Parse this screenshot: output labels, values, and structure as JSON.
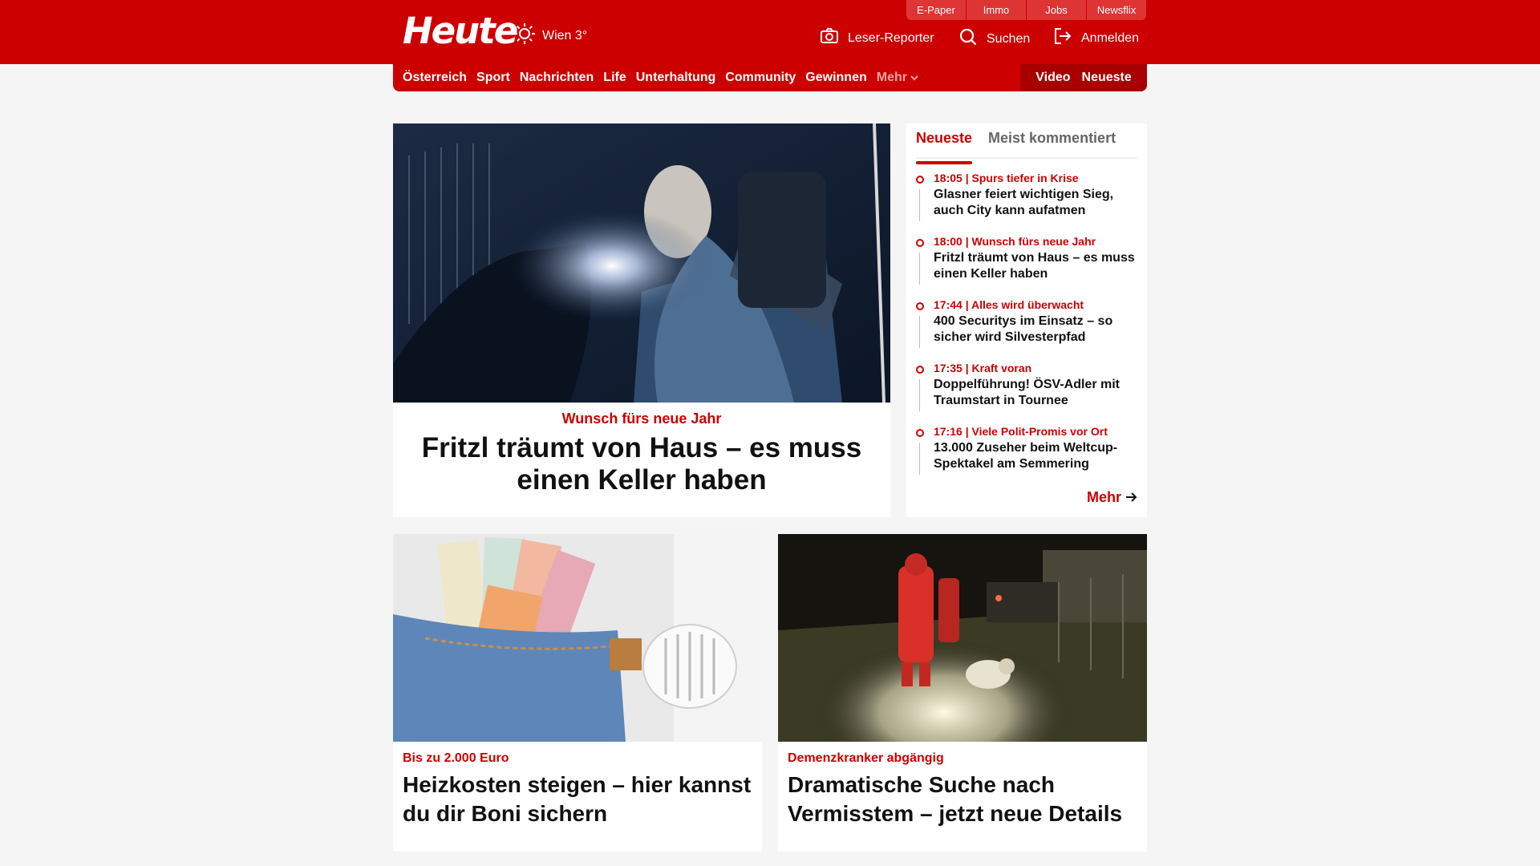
{
  "header": {
    "logo": "Heute",
    "weather": {
      "icon": "sun-icon",
      "text": "Wien 3°"
    },
    "top_links": [
      "E-Paper",
      "Immo",
      "Jobs",
      "Newsflix"
    ],
    "actions": [
      {
        "icon": "camera-icon",
        "label": "Leser-Reporter"
      },
      {
        "icon": "search-icon",
        "label": "Suchen"
      },
      {
        "icon": "login-icon",
        "label": "Anmelden"
      }
    ]
  },
  "nav": {
    "items": [
      "Österreich",
      "Sport",
      "Nachrichten",
      "Life",
      "Unterhaltung",
      "Community",
      "Gewinnen"
    ],
    "more": "Mehr",
    "right": [
      "Video",
      "Neueste"
    ]
  },
  "hero": {
    "kicker": "Wunsch fürs neue Jahr",
    "title": "Fritzl träumt von Haus – es muss einen Keller haben"
  },
  "sidebar": {
    "tabs": [
      "Neueste",
      "Meist kommentiert"
    ],
    "items": [
      {
        "time": "18:05",
        "topic": "Spurs tiefer in Krise",
        "title": "Glasner feiert wichtigen Sieg, auch City kann aufatmen"
      },
      {
        "time": "18:00",
        "topic": "Wunsch fürs neue Jahr",
        "title": "Fritzl träumt von Haus – es muss einen Keller haben"
      },
      {
        "time": "17:44",
        "topic": "Alles wird überwacht",
        "title": "400 Securitys im Einsatz – so sicher wird Silvesterpfad"
      },
      {
        "time": "17:35",
        "topic": "Kraft voran",
        "title": "Doppelführung! ÖSV-Adler mit Traumstart in Tournee"
      },
      {
        "time": "17:16",
        "topic": "Viele Polit-Promis vor Ort",
        "title": "13.000 Zuseher beim Weltcup-Spektakel am Semmering"
      }
    ],
    "more": "Mehr"
  },
  "cards": [
    {
      "kicker": "Bis zu 2.000 Euro",
      "title": "Heizkosten steigen – hier kannst du dir Boni sichern"
    },
    {
      "kicker": "Demenzkranker abgängig",
      "title": "Dramatische Suche nach Vermisstem – jetzt neue Details"
    }
  ],
  "colors": {
    "brand": "#cc0000",
    "brand_dark": "#a80000",
    "background": "#f5f5f5"
  }
}
